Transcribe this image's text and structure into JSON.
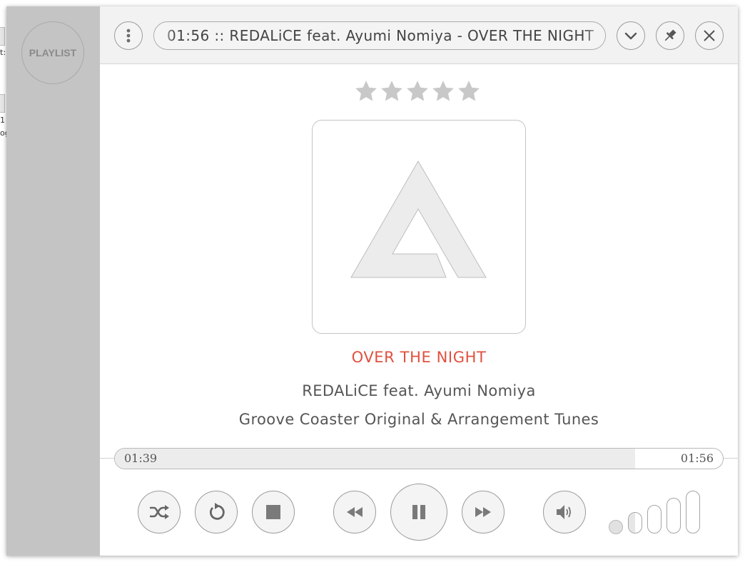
{
  "window": {
    "now_playing_ticker": "01:56 :: REDALiCE feat. Ayumi Nomiya - OVER THE NIGHT",
    "playlist_label": "PLAYLIST"
  },
  "desktop": {
    "fragments": [
      "t:",
      "1",
      "og"
    ]
  },
  "track": {
    "title": "OVER THE NIGHT",
    "artist": "REDALiCE feat. Ayumi Nomiya",
    "album": "Groove Coaster Original & Arrangement Tunes",
    "rating": 0,
    "rating_max": 5
  },
  "playback": {
    "current_time": "01:39",
    "total_time": "01:56",
    "progress": 0.856,
    "state": "playing"
  },
  "volume": {
    "levels": 5,
    "level": 1
  },
  "icons": {
    "menu": "menu-dots-icon",
    "collapse": "chevron-down-icon",
    "pin": "pin-icon",
    "close": "close-icon",
    "shuffle": "shuffle-icon",
    "repeat": "repeat-icon",
    "stop": "stop-icon",
    "previous": "rewind-icon",
    "pause": "pause-icon",
    "next": "fast-forward-icon",
    "volume": "speaker-icon"
  },
  "colors": {
    "title": "#e0503f",
    "sidebar": "#c4c4c4",
    "icon": "#7a7a7a",
    "star": "#c8c8c8"
  }
}
